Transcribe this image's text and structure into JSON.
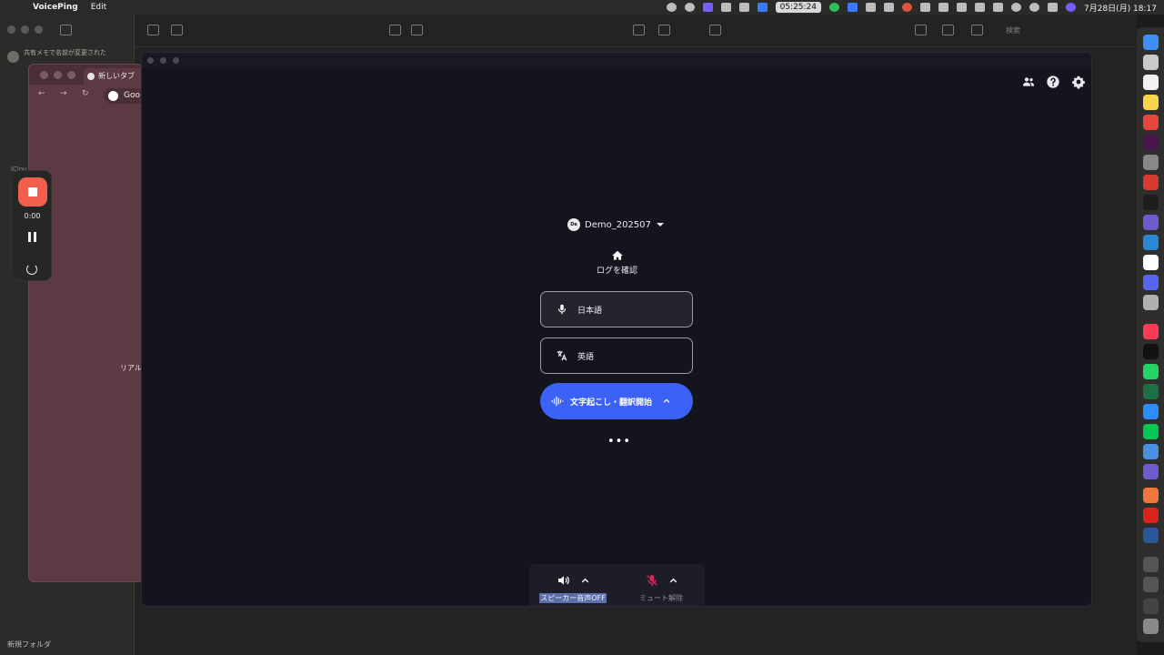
{
  "menubar": {
    "app_name": "VoicePing",
    "menu_edit": "Edit",
    "timer": "05:25:24",
    "datetime": "7月28日(月) 18:17"
  },
  "notes": {
    "notification": "共有メモで名前が変更された",
    "sidebar_label": "iClou",
    "new_folder": "新規フォルダ",
    "search_placeholder": "検索"
  },
  "browser": {
    "tab_title": "新しいタブ",
    "url_text": "Goo",
    "page_text": "リアル"
  },
  "recorder": {
    "elapsed": "0:00"
  },
  "voiceping": {
    "room_avatar": "De",
    "room_name": "Demo_202507",
    "log_label": "ログを確認",
    "source_language": "日本語",
    "target_language": "英語",
    "start_label": "文字起こし・翻訳開始",
    "speaker_label": "スピーカー音声OFF",
    "mute_label": "ミュート解除"
  },
  "colors": {
    "accent": "#3b61f5",
    "window_bg": "#14141e",
    "mic_muted": "#e0245e",
    "record": "#f25f4c"
  },
  "icons": [
    "members-icon",
    "help-icon",
    "settings-icon",
    "home-icon",
    "mic-icon",
    "translate-icon",
    "waveform-icon",
    "chevron-up-icon",
    "more-icon",
    "speaker-icon",
    "mic-off-icon"
  ]
}
